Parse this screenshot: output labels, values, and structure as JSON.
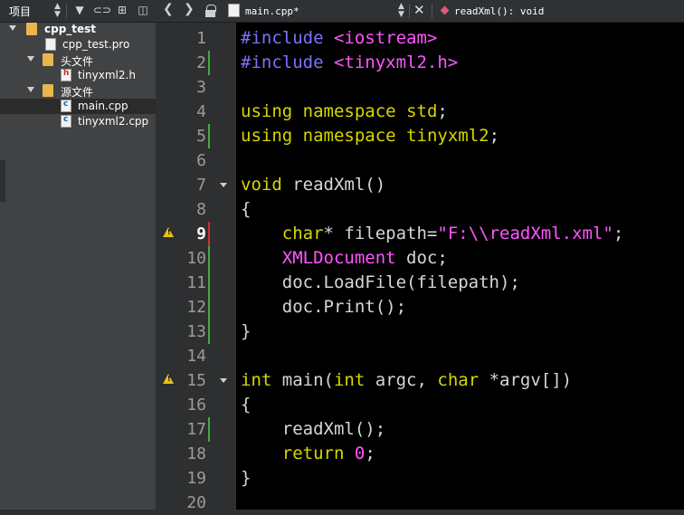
{
  "left_panel": {
    "title": "项目",
    "tree": [
      {
        "label": "cpp_test",
        "kind": "project"
      },
      {
        "label": "cpp_test.pro",
        "kind": "file"
      },
      {
        "label": "头文件",
        "kind": "folder"
      },
      {
        "label": "tinyxml2.h",
        "kind": "header"
      },
      {
        "label": "源文件",
        "kind": "folder"
      },
      {
        "label": "main.cpp",
        "kind": "source",
        "selected": true
      },
      {
        "label": "tinyxml2.cpp",
        "kind": "source"
      }
    ]
  },
  "editor_toolbar": {
    "file_name": "main.cpp*",
    "function_name": "readXml(): void"
  },
  "line_numbers": [
    "1",
    "2",
    "3",
    "4",
    "5",
    "6",
    "7",
    "8",
    "9",
    "10",
    "11",
    "12",
    "13",
    "14",
    "15",
    "16",
    "17",
    "18",
    "19",
    "20"
  ],
  "code": {
    "l1": {
      "a": "#include",
      "b": "<iostream>"
    },
    "l2": {
      "a": "#include",
      "b": "<tinyxml2.h>"
    },
    "l4": {
      "a": "using",
      "b": "namespace",
      "c": "std",
      "d": ";"
    },
    "l5": {
      "a": "using",
      "b": "namespace",
      "c": "tinyxml2",
      "d": ";"
    },
    "l7": {
      "a": "void",
      "b": " readXml()"
    },
    "l8": {
      "a": "{"
    },
    "l9": {
      "a": "char",
      "b": "* filepath=",
      "c": "\"F:\\\\readXml.xml\"",
      "d": ";"
    },
    "l10": {
      "a": "XMLDocument",
      "b": " doc;"
    },
    "l11": {
      "a": "doc.LoadFile(filepath);"
    },
    "l12": {
      "a": "doc.Print();"
    },
    "l13": {
      "a": "}"
    },
    "l15": {
      "a": "int",
      "b": " main(",
      "c": "int",
      "d": " argc, ",
      "e": "char",
      "f": " *argv[])"
    },
    "l16": {
      "a": "{"
    },
    "l17": {
      "a": "readXml();"
    },
    "l18": {
      "a": "return",
      "b": "0",
      "c": ";"
    },
    "l19": {
      "a": "}"
    }
  },
  "colors": {
    "keyword": "#d7d700",
    "preprocessor": "#7b73ff",
    "string": "#ff56ff",
    "warning": "#e8c21a",
    "changed_line": "#3fae3f",
    "unsaved_line": "#c83232"
  }
}
